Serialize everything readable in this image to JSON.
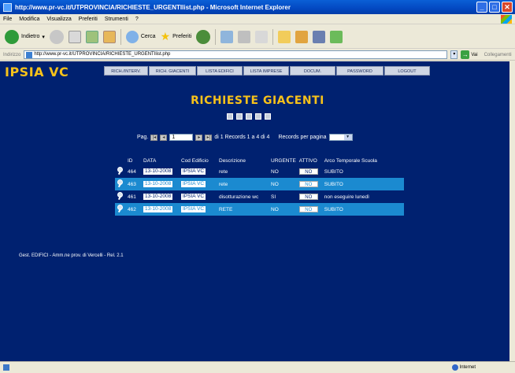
{
  "window": {
    "title": "http://www.pr-vc.it/UTPROVINCIA/RICHIESTE_URGENTIlist.php - Microsoft Internet Explorer"
  },
  "menubar": [
    "File",
    "Modifica",
    "Visualizza",
    "Preferiti",
    "Strumenti",
    "?"
  ],
  "toolbar": {
    "back_label": "Indietro",
    "search_label": "Cerca",
    "favorites_label": "Preferiti"
  },
  "address": {
    "label": "Indirizzo",
    "url": "http://www.pr-vc.it/UTPROVINCIA/RICHIESTE_URGENTIlist.php",
    "go_label": "Vai",
    "links_label": "Collegamenti"
  },
  "site": {
    "logo": "IPSIA VC",
    "nav": [
      "RICH./INTERV.",
      "RICH. GIACENTI",
      "LISTA EDIFICI",
      "LISTA IMPRESE",
      "DOCUM.",
      "PASSWORD",
      "LOGOUT"
    ]
  },
  "page": {
    "heading": "RICHIESTE GIACENTI"
  },
  "pager": {
    "prefix": "Pag.",
    "current_page": "1",
    "summary": "di 1 Records 1 a 4 di 4",
    "per_page_label": "Records per pagina"
  },
  "table": {
    "headers": [
      "",
      "ID",
      "DATA",
      "Cod Edificio",
      "Descrizione",
      "URGENTE",
      "ATTIVO",
      "Arco Temporale Scuola"
    ],
    "rows": [
      {
        "id": "464",
        "data": "13-10-2008",
        "edificio": "IPSIA VC",
        "descrizione": "rete",
        "urgente": "NO",
        "attivo": "NO",
        "arco": "SUBITO"
      },
      {
        "id": "463",
        "data": "13-10-2008",
        "edificio": "IPSIA VC",
        "descrizione": "rete",
        "urgente": "NO",
        "attivo": "NO",
        "arco": "SUBITO"
      },
      {
        "id": "461",
        "data": "13-10-2008",
        "edificio": "IPSIA VC",
        "descrizione": "disotturazione wc",
        "urgente": "SI",
        "attivo": "NO",
        "arco": "non eseguire lunedì"
      },
      {
        "id": "462",
        "data": "13-10-2008",
        "edificio": "IPSIA VC",
        "descrizione": "RETE",
        "urgente": "NO",
        "attivo": "NO",
        "arco": "SUBITO"
      }
    ]
  },
  "footer": {
    "text": "Gest. EDIFICI - Amm.ne prov. di Vercelli - Rel. 2.1"
  },
  "status": {
    "zone": "Internet"
  }
}
